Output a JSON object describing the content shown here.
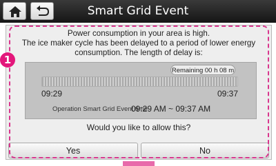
{
  "header": {
    "title": "Smart Grid Event",
    "home_icon": "home-icon",
    "back_icon": "back-arrow-icon"
  },
  "popup": {
    "message_lines": [
      "Power consumption in your area is high.",
      "The ice maker cycle has been delayed to a period of lower energy",
      "consumption. The length of delay is:"
    ],
    "remaining_label": "Remaining 00 h 08 m",
    "progress_fraction": 0.0,
    "start_time": "09:29",
    "end_time": "09:37",
    "operation_label": "Operation Smart Grid Event time",
    "operation_value": "09:29 AM ~ 09:37 AM",
    "question": "Would you like to allow this?",
    "yes_label": "Yes",
    "no_label": "No"
  },
  "callout": {
    "number": "1",
    "color": "#e3177b"
  },
  "colors": {
    "highlight_border": "#d9368e",
    "titlebar": "#222222"
  }
}
